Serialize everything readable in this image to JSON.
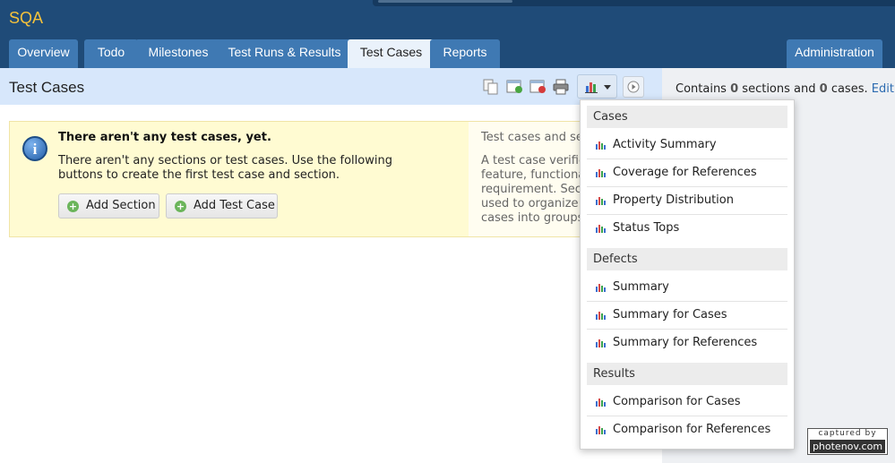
{
  "app": {
    "title": "SQA"
  },
  "nav": {
    "tabs": [
      {
        "label": "Overview"
      },
      {
        "label": "Todo"
      },
      {
        "label": "Milestones"
      },
      {
        "label": "Test Runs & Results"
      },
      {
        "label": "Test Cases"
      },
      {
        "label": "Reports"
      }
    ],
    "admin_label": "Administration",
    "active_tab": "Test Cases"
  },
  "page": {
    "title": "Test Cases"
  },
  "sidebar": {
    "prefix": "Contains",
    "sections_count": "0",
    "sections_word": "sections and",
    "cases_count": "0",
    "cases_word": "cases.",
    "edit_label": "Edit"
  },
  "notice": {
    "title": "There aren't any test cases, yet.",
    "body": "There aren't any sections or test cases. Use the following buttons to create the first test case and section.",
    "add_section_label": "Add Section",
    "add_test_case_label": "Add Test Case",
    "side_title": "Test cases and sec",
    "side_body": "A test case verifie\nfeature, functional\nrequirement. Sect\nused to organize r\ncases into groups."
  },
  "report_menu": {
    "sections": [
      {
        "title": "Cases",
        "items": [
          "Activity Summary",
          "Coverage for References",
          "Property Distribution",
          "Status Tops"
        ]
      },
      {
        "title": "Defects",
        "items": [
          "Summary",
          "Summary for Cases",
          "Summary for References"
        ]
      },
      {
        "title": "Results",
        "items": [
          "Comparison for Cases",
          "Comparison for References"
        ]
      }
    ]
  },
  "watermark": {
    "line1": "captured by",
    "line2": "photenov.com"
  },
  "colors": {
    "topbar": "#1f4b78",
    "tab": "#3f79b3",
    "brand": "#f5c23b",
    "header": "#d7e7fb",
    "notice": "#fffbd2",
    "link": "#2c6bb0"
  },
  "icons": [
    "copy-icon",
    "export-icon",
    "delete-export-icon",
    "print-icon",
    "bar-chart-icon",
    "chevron-down-icon",
    "run-icon",
    "info-icon",
    "plus-icon"
  ]
}
